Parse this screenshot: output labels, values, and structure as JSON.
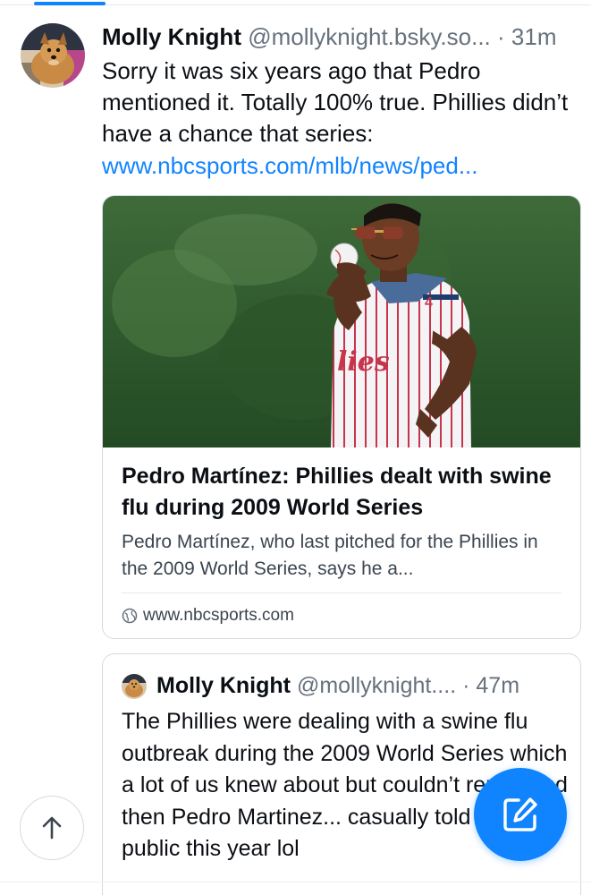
{
  "colors": {
    "accent": "#1083fe",
    "text": "#0b0f14",
    "muted": "#66717d",
    "border": "#d4dbe2"
  },
  "post": {
    "author_name": "Molly Knight",
    "author_handle": "@mollyknight.bsky.so...",
    "separator": "·",
    "time": "31m",
    "text": "Sorry it was six years ago that Pedro mentioned it. Totally 100% true. Phillies didn’t have a chance that series:",
    "link": "www.nbcsports.com/mlb/news/ped..."
  },
  "link_card": {
    "title": "Pedro Martínez: Phillies dealt with swine flu during 2009 World Series",
    "description": "Pedro Martínez, who last pitched for the Phillies in the 2009 World Series, says he a...",
    "domain": "www.nbcsports.com",
    "domain_icon": "globe-icon",
    "jersey_lettering": "lies",
    "jersey_number": "4"
  },
  "quote": {
    "author_name": "Molly Knight",
    "author_handle": "@mollyknight....",
    "separator": "·",
    "time": "47m",
    "text": "The Phillies were dealing with a swine flu outbreak during the 2009 World Series which a lot of us knew about but couldn’t report and then Pedro Martinez... casually told the public this year lol"
  },
  "buttons": {
    "scroll_top_icon": "arrow-up-icon",
    "compose_icon": "compose-icon"
  }
}
